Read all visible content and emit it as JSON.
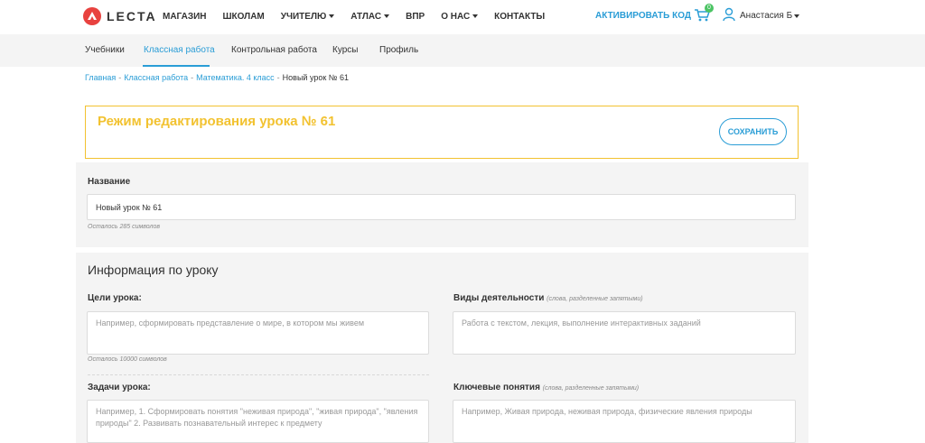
{
  "header": {
    "logo_text": "LECTA",
    "nav": [
      {
        "label": "МАГАЗИН",
        "dropdown": false
      },
      {
        "label": "ШКОЛАМ",
        "dropdown": false
      },
      {
        "label": "УЧИТЕЛЮ",
        "dropdown": true
      },
      {
        "label": "АТЛАС",
        "dropdown": true
      },
      {
        "label": "ВПР",
        "dropdown": false
      },
      {
        "label": "О НАС",
        "dropdown": true
      },
      {
        "label": "КОНТАКТЫ",
        "dropdown": false
      }
    ],
    "activate_label": "АКТИВИРОВАТЬ КОД",
    "cart_count": "0",
    "user_name": "Анастасия Б"
  },
  "subnav": {
    "items": [
      "Учебники",
      "Классная работа",
      "Контрольная работа",
      "Курсы",
      "Профиль"
    ],
    "active": "Классная работа"
  },
  "breadcrumb": {
    "links": [
      "Главная",
      "Классная работа",
      "Математика. 4 класс"
    ],
    "current": "Новый урок № 61"
  },
  "mode": {
    "title": "Режим редактирования урока № 61",
    "save_label": "СОХРАНИТЬ"
  },
  "name_section": {
    "label": "Название",
    "value": "Новый урок № 61",
    "counter": "Осталось 285 символов"
  },
  "info": {
    "title": "Информация по уроку",
    "goals_label": "Цели урока:",
    "goals_placeholder": "Например, сформировать представление о мире, в котором мы живем",
    "goals_counter": "Осталось 10000 символов",
    "activities_label": "Виды деятельности",
    "activities_hint": "(слова, разделенные запятыми)",
    "activities_placeholder": "Работа с текстом, лекция, выполнение интерактивных заданий",
    "tasks_label": "Задачи урока:",
    "tasks_placeholder": "Например, 1. Сформировать понятия \"неживая природа\", \"живая природа\", \"явления природы\" 2. Развивать познавательный интерес к предмету",
    "concepts_label": "Ключевые понятия",
    "concepts_hint": "(слова, разделенные запятыми)",
    "concepts_placeholder": "Например, Живая природа, неживая природа, физические явления природы"
  },
  "colors": {
    "accent": "#2a9dd6",
    "highlight": "#f2c230",
    "logo": "#e8423f",
    "badge": "#4cc464"
  }
}
